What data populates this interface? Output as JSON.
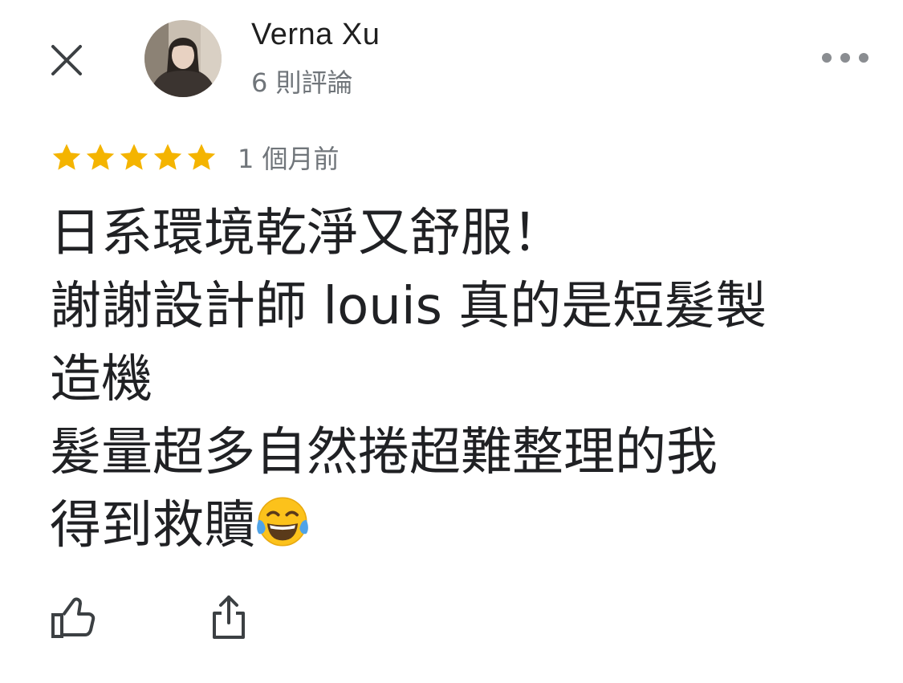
{
  "header": {
    "close_icon": "close-icon",
    "author_name": "Verna Xu",
    "review_count": "6 則評論",
    "more_icon": "more-horizontal-icon"
  },
  "review": {
    "rating": 5,
    "max_rating": 5,
    "star_color": "#f4b400",
    "time_ago": "1 個月前",
    "lines": [
      "日系環境乾淨又舒服！",
      "謝謝設計師 louis 真的是短髮製",
      "造機",
      "髮量超多自然捲超難整理的我",
      "得到救贖"
    ],
    "emoji_icon": "face-with-tears-of-joy-icon"
  },
  "actions": {
    "like_icon": "thumbs-up-icon",
    "share_icon": "share-icon"
  }
}
